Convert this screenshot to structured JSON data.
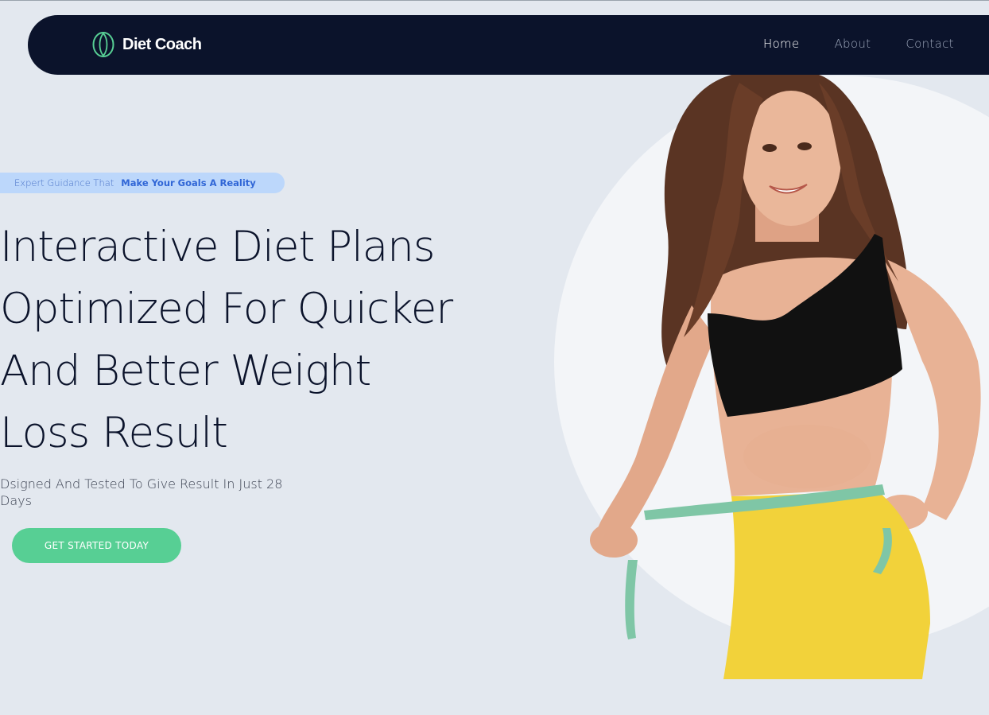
{
  "brand": {
    "name": "Diet Coach",
    "logo_icon": "leaf-ring-icon",
    "accent": "#57cf94"
  },
  "nav": {
    "items": [
      {
        "label": "Home",
        "active": true
      },
      {
        "label": "About",
        "active": false
      },
      {
        "label": "Contact",
        "active": false
      }
    ]
  },
  "hero": {
    "badge_plain": "Expert Guidance That",
    "badge_bold": "Make Your Goals A Reality",
    "headline_lines": [
      "Interactive Diet Plans",
      "Optimized For Quicker",
      "And Better Weight",
      "Loss Result"
    ],
    "subtext_line1": "Dsigned And Tested To Give Result In Just 28",
    "subtext_line2": "Days",
    "cta_label": "GET STARTED TODAY",
    "image": "woman-measuring-waist-photo"
  },
  "colors": {
    "navbar_bg": "#0b132b",
    "page_bg": "#e3e8ef",
    "badge_bg": "#bcd7fb",
    "badge_text": "#3066d6",
    "headline": "#0b132b",
    "cta_bg": "#57cf94"
  }
}
